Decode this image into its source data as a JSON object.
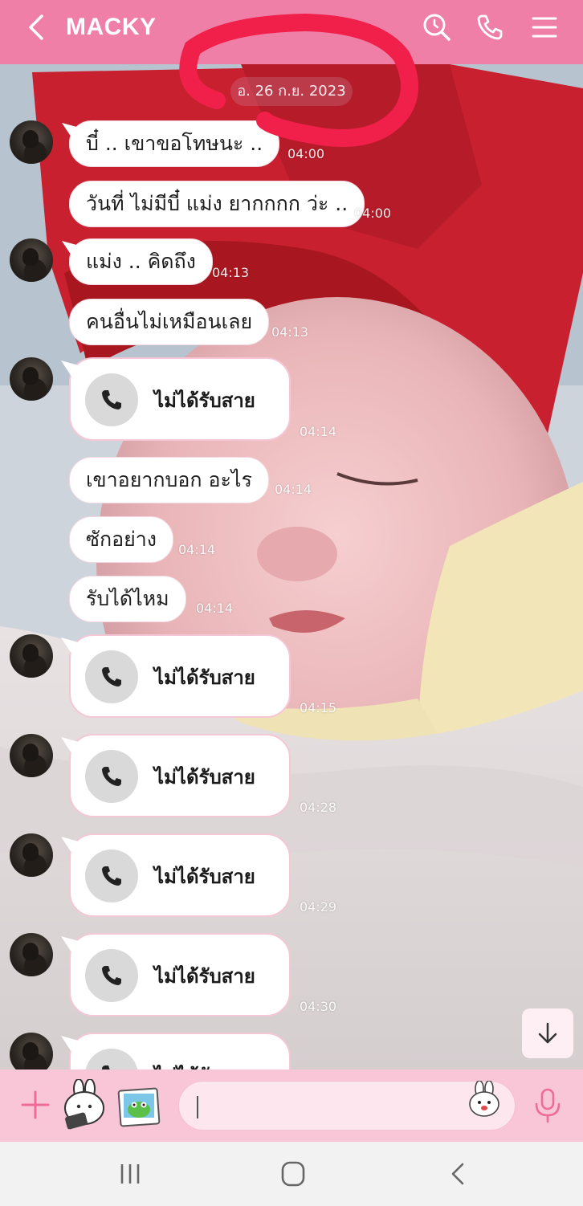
{
  "header": {
    "title": "MACKY",
    "back_icon": "chevron-left-icon",
    "search_icon": "search-history-icon",
    "call_icon": "phone-icon",
    "menu_icon": "menu-icon",
    "color": "#f07fa8"
  },
  "date": "อ. 26 ก.ย. 2023",
  "messages": [
    {
      "type": "text",
      "text": "บี๋ .. เขาขอโทษนะ ..",
      "time": "04:00"
    },
    {
      "type": "text",
      "text": "วันที่ ไม่มีบี๋ แม่ง ยากกกก ว่ะ ..",
      "time": "04:00"
    },
    {
      "type": "text",
      "text": "แม่ง .. คิดถึง",
      "time": "04:13"
    },
    {
      "type": "text",
      "text": "คนอื่นไม่เหมือนเลย",
      "time": "04:13"
    },
    {
      "type": "call",
      "text": "ไม่ได้รับสาย",
      "time": "04:14"
    },
    {
      "type": "text",
      "text": "เขาอยากบอก อะไร",
      "time": "04:14"
    },
    {
      "type": "text",
      "text": "ซักอย่าง",
      "time": "04:14"
    },
    {
      "type": "text",
      "text": "รับได้ไหม",
      "time": "04:14"
    },
    {
      "type": "call",
      "text": "ไม่ได้รับสาย",
      "time": "04:15"
    },
    {
      "type": "call",
      "text": "ไม่ได้รับสาย",
      "time": "04:28"
    },
    {
      "type": "call",
      "text": "ไม่ได้รับสาย",
      "time": "04:29"
    },
    {
      "type": "call",
      "text": "ไม่ได้รับสาย",
      "time": "04:30"
    },
    {
      "type": "call",
      "text": "ไม่ได้รับสาย",
      "time": ""
    }
  ],
  "input_bar": {
    "placeholder": "",
    "plus_icon": "plus-icon",
    "sticker_icon": "sticker-icon",
    "gallery_icon": "gallery-icon",
    "emoji_icon": "emoji-icon",
    "mic_icon": "microphone-icon",
    "color": "#f9c6d8"
  },
  "scroll_down_icon": "arrow-down-icon",
  "system_nav": {
    "recents_icon": "recent-apps-icon",
    "home_icon": "home-icon",
    "back_icon": "back-icon"
  }
}
